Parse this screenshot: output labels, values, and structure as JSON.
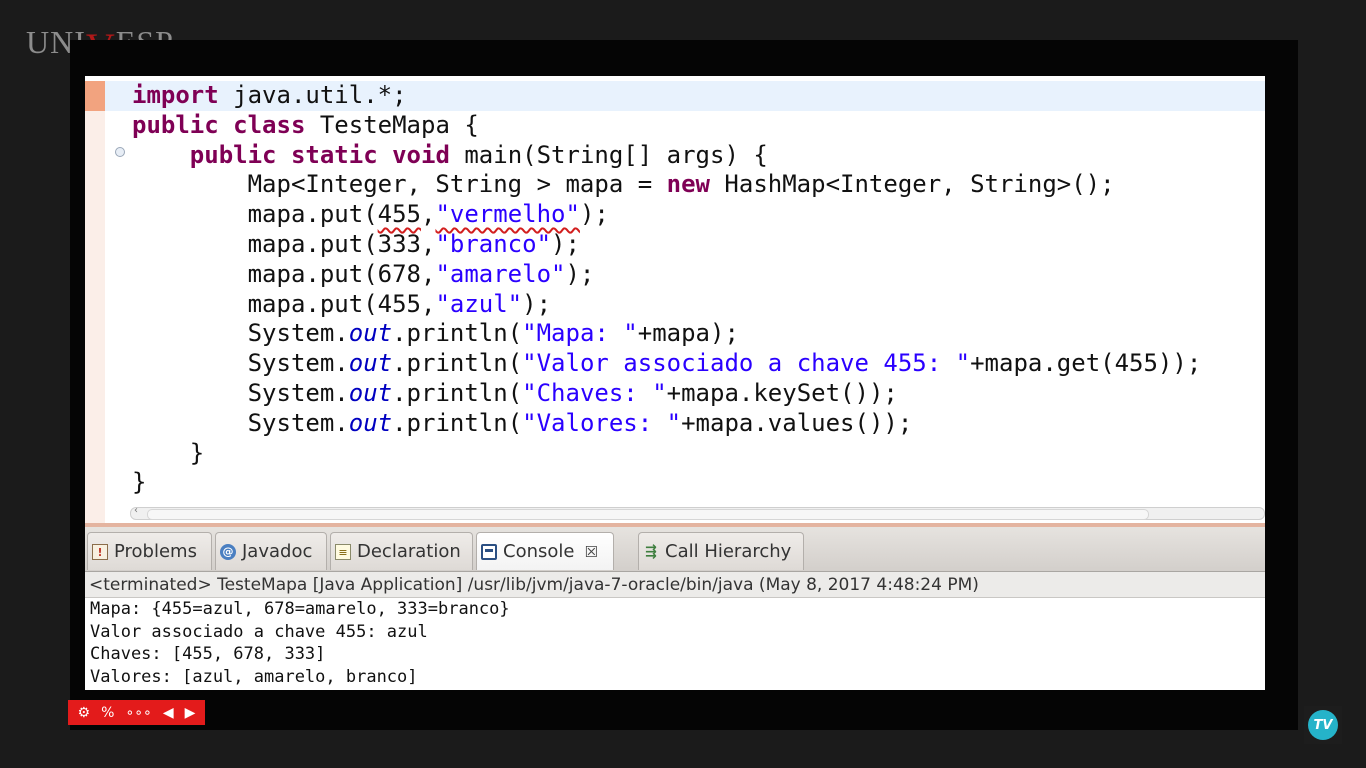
{
  "branding": {
    "logo_left": "UNI",
    "logo_v": "V",
    "logo_right": "ESP",
    "badge_text": "TV"
  },
  "editor": {
    "lines": [
      {
        "indent": "",
        "parts": [
          {
            "t": "import",
            "c": "kw"
          },
          {
            "t": " java.util.*;",
            "c": ""
          }
        ]
      },
      {
        "indent": "",
        "parts": [
          {
            "t": "public",
            "c": "kw"
          },
          {
            "t": " ",
            "c": ""
          },
          {
            "t": "class",
            "c": "kw"
          },
          {
            "t": " TesteMapa {",
            "c": ""
          }
        ]
      },
      {
        "indent": "    ",
        "parts": [
          {
            "t": "public",
            "c": "kw"
          },
          {
            "t": " ",
            "c": ""
          },
          {
            "t": "static",
            "c": "kw"
          },
          {
            "t": " ",
            "c": ""
          },
          {
            "t": "void",
            "c": "kw"
          },
          {
            "t": " main(String[] args) {",
            "c": ""
          }
        ]
      },
      {
        "indent": "        ",
        "parts": [
          {
            "t": "Map<Integer, String > mapa = ",
            "c": ""
          },
          {
            "t": "new",
            "c": "kw"
          },
          {
            "t": " HashMap<Integer, String>();",
            "c": ""
          }
        ]
      },
      {
        "indent": "        ",
        "parts": [
          {
            "t": "mapa.put(",
            "c": ""
          },
          {
            "t": "455",
            "c": "squig"
          },
          {
            "t": ",",
            "c": ""
          },
          {
            "t": "\"vermelho\"",
            "c": "str squig"
          },
          {
            "t": ");",
            "c": ""
          }
        ]
      },
      {
        "indent": "        ",
        "parts": [
          {
            "t": "mapa.put(333,",
            "c": ""
          },
          {
            "t": "\"branco\"",
            "c": "str"
          },
          {
            "t": ");",
            "c": ""
          }
        ]
      },
      {
        "indent": "        ",
        "parts": [
          {
            "t": "mapa.put(678,",
            "c": ""
          },
          {
            "t": "\"amarelo\"",
            "c": "str"
          },
          {
            "t": ");",
            "c": ""
          }
        ]
      },
      {
        "indent": "        ",
        "parts": [
          {
            "t": "mapa.put(455,",
            "c": ""
          },
          {
            "t": "\"azul\"",
            "c": "str"
          },
          {
            "t": ");",
            "c": ""
          }
        ]
      },
      {
        "indent": "        ",
        "parts": [
          {
            "t": "System.",
            "c": ""
          },
          {
            "t": "out",
            "c": "fld"
          },
          {
            "t": ".println(",
            "c": ""
          },
          {
            "t": "\"Mapa: \"",
            "c": "str"
          },
          {
            "t": "+mapa);",
            "c": ""
          }
        ]
      },
      {
        "indent": "        ",
        "parts": [
          {
            "t": "System.",
            "c": ""
          },
          {
            "t": "out",
            "c": "fld"
          },
          {
            "t": ".println(",
            "c": ""
          },
          {
            "t": "\"Valor associado a chave 455: \"",
            "c": "str"
          },
          {
            "t": "+mapa.get(455));",
            "c": ""
          }
        ]
      },
      {
        "indent": "        ",
        "parts": [
          {
            "t": "System.",
            "c": ""
          },
          {
            "t": "out",
            "c": "fld"
          },
          {
            "t": ".println(",
            "c": ""
          },
          {
            "t": "\"Chaves: \"",
            "c": "str"
          },
          {
            "t": "+mapa.keySet());",
            "c": ""
          }
        ]
      },
      {
        "indent": "        ",
        "parts": [
          {
            "t": "System.",
            "c": ""
          },
          {
            "t": "out",
            "c": "fld"
          },
          {
            "t": ".println(",
            "c": ""
          },
          {
            "t": "\"Valores: \"",
            "c": "str"
          },
          {
            "t": "+mapa.values());",
            "c": ""
          }
        ]
      },
      {
        "indent": "    ",
        "parts": [
          {
            "t": "}",
            "c": ""
          }
        ]
      },
      {
        "indent": "",
        "parts": [
          {
            "t": "}",
            "c": ""
          }
        ]
      }
    ]
  },
  "tabs": [
    {
      "label": "Problems",
      "icon": "problems-icon",
      "active": false
    },
    {
      "label": "Javadoc",
      "icon": "javadoc-icon",
      "active": false
    },
    {
      "label": "Declaration",
      "icon": "declaration-icon",
      "active": false
    },
    {
      "label": "Console",
      "icon": "console-icon",
      "active": true,
      "close": "☒"
    },
    {
      "label": "Call Hierarchy",
      "icon": "call-hierarchy-icon",
      "active": false
    }
  ],
  "console": {
    "header": "<terminated> TesteMapa [Java Application] /usr/lib/jvm/java-7-oracle/bin/java (May 8, 2017 4:48:24 PM)",
    "output": [
      "Mapa: {455=azul, 678=amarelo, 333=branco}",
      "Valor associado a chave 455: azul",
      "Chaves: [455, 678, 333]",
      "Valores: [azul, amarelo, branco]"
    ]
  },
  "colors": {
    "keyword": "#7f0055",
    "string": "#2a00ff",
    "static_field": "#0000c0",
    "player_bar": "#e31b1b",
    "badge": "#25b3c9"
  }
}
